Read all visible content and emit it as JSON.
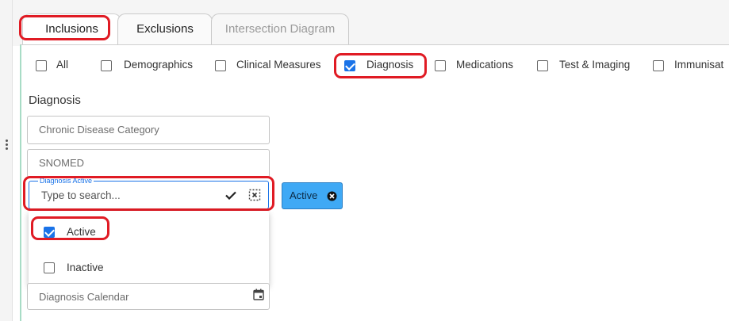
{
  "tabs": [
    {
      "label": "Inclusions",
      "state": "active"
    },
    {
      "label": "Exclusions",
      "state": "normal"
    },
    {
      "label": "Intersection Diagram",
      "state": "disabled"
    }
  ],
  "filters": [
    {
      "label": "All",
      "checked": false
    },
    {
      "label": "Demographics",
      "checked": false
    },
    {
      "label": "Clinical Measures",
      "checked": false
    },
    {
      "label": "Diagnosis",
      "checked": true
    },
    {
      "label": "Medications",
      "checked": false
    },
    {
      "label": "Test & Imaging",
      "checked": false
    },
    {
      "label": "Immunisat",
      "checked": false
    }
  ],
  "diagnosis": {
    "section_title": "Diagnosis",
    "category_field": {
      "placeholder": "Chronic Disease Category"
    },
    "snomed_field": {
      "placeholder": "SNOMED"
    },
    "active_field": {
      "legend": "Diagnosis Active",
      "placeholder": "Type to search...",
      "value": ""
    },
    "selected_chip": {
      "label": "Active"
    },
    "dropdown_options": [
      {
        "label": "Active",
        "checked": true
      },
      {
        "label": "Inactive",
        "checked": false
      }
    ],
    "calendar_field": {
      "placeholder": "Diagnosis Calendar"
    }
  },
  "colors": {
    "highlight": "#e01b24",
    "accent": "#1a73e8",
    "chip": "#3fa9f5",
    "content_border": "#a8dcc6"
  },
  "icons": [
    "drag-handle-icon",
    "checkmark-icon",
    "clear-selection-icon",
    "chip-close-icon",
    "calendar-icon"
  ]
}
